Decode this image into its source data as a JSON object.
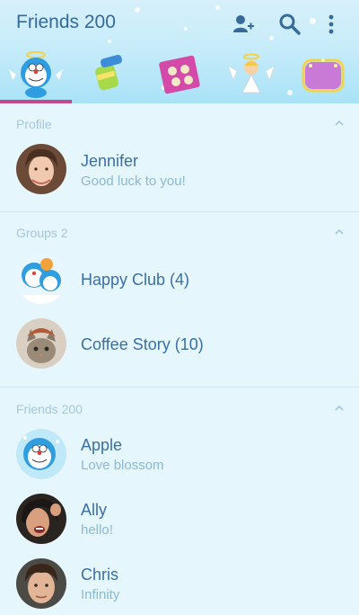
{
  "header": {
    "title": "Friends 200",
    "icons": [
      "add-friend-icon",
      "search-icon",
      "more-menu-icon"
    ]
  },
  "tabs": [
    {
      "name": "doraemon-angel-tab"
    },
    {
      "name": "bamboo-copter-tab"
    },
    {
      "name": "dorayaki-bag-tab"
    },
    {
      "name": "angel-tab"
    },
    {
      "name": "treasure-box-tab"
    }
  ],
  "profile": {
    "section_label": "Profile",
    "name": "Jennifer",
    "status": "Good luck to you!"
  },
  "groups": {
    "section_label": "Groups 2",
    "items": [
      {
        "name": "Happy Club (4)"
      },
      {
        "name": "Coffee Story (10)"
      }
    ]
  },
  "friends": {
    "section_label": "Friends 200",
    "items": [
      {
        "name": "Apple",
        "status": "Love blossom"
      },
      {
        "name": "Ally",
        "status": "hello!"
      },
      {
        "name": "Chris",
        "status": "Infinity"
      }
    ]
  },
  "colors": {
    "accent": "#c4498a",
    "title": "#356a9a",
    "name": "#3b6fa5",
    "status": "#8cb8d6",
    "section": "#a3c7de",
    "background": "#e6f6fd"
  }
}
